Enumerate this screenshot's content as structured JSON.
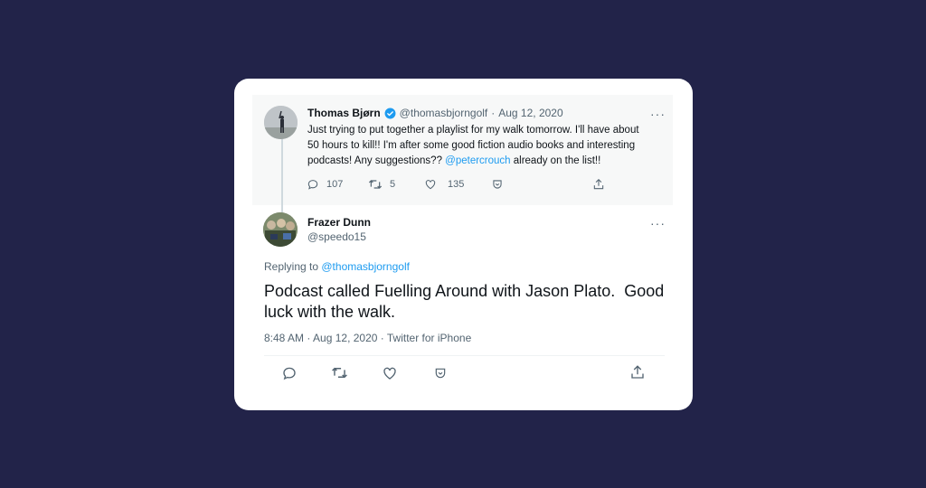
{
  "parent_tweet": {
    "display_name": "Thomas Bjørn",
    "handle": "@thomasbjorngolf",
    "separator": "·",
    "date": "Aug 12, 2020",
    "text_part1": "Just trying to put together a playlist for my walk tomorrow. I'll have about 50 hours to kill!! I'm after some good fiction audio books and interesting podcasts! Any suggestions?? ",
    "text_mention": "@petercrouch",
    "text_part2": " already on the list!!",
    "replies": "107",
    "retweets": "5",
    "likes": "135",
    "more": "···"
  },
  "reply_tweet": {
    "display_name": "Frazer Dunn",
    "handle": "@speedo15",
    "replying_prefix": "Replying to ",
    "replying_to": "@thomasbjorngolf",
    "text": "Podcast called Fuelling Around with Jason Plato.  Good luck with the walk.",
    "meta": "8:48 AM · Aug 12, 2020 · Twitter for iPhone",
    "more": "···"
  },
  "colors": {
    "background": "#222349",
    "card": "#ffffff",
    "link": "#1d9bf0",
    "verified": "#1d9bf0",
    "muted": "#536471"
  },
  "icons": [
    "verified-badge-icon",
    "reply-icon",
    "retweet-icon",
    "like-icon",
    "save-icon",
    "share-icon",
    "more-icon"
  ]
}
